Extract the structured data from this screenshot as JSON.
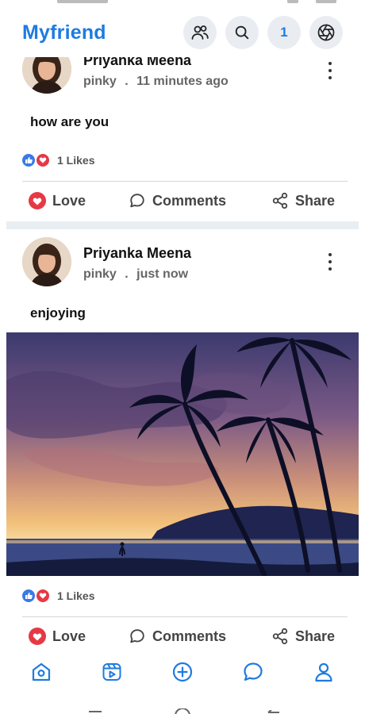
{
  "header": {
    "brand": "Myfriend",
    "notification_count": "1",
    "accent_color": "#1e7be0",
    "icons": [
      "friends-icon",
      "search-icon",
      "camera-aperture-icon"
    ]
  },
  "posts": [
    {
      "author": "Priyanka Meena",
      "username": "pinky",
      "separator": ".",
      "time": "11 minutes ago",
      "text": "how are you",
      "likes": "1 Likes",
      "actions": {
        "love": "Love",
        "comments": "Comments",
        "share": "Share"
      }
    },
    {
      "author": "Priyanka Meena",
      "username": "pinky",
      "separator": ".",
      "time": "just now",
      "text": "enjoying",
      "likes": "1 Likes",
      "image": "sunset-palm-trees-beach",
      "actions": {
        "love": "Love",
        "comments": "Comments",
        "share": "Share"
      }
    }
  ],
  "bottom_nav": {
    "active_color": "#1e7be0",
    "items": [
      "home-icon",
      "video-icon",
      "add-post-icon",
      "chat-icon",
      "profile-icon"
    ]
  }
}
